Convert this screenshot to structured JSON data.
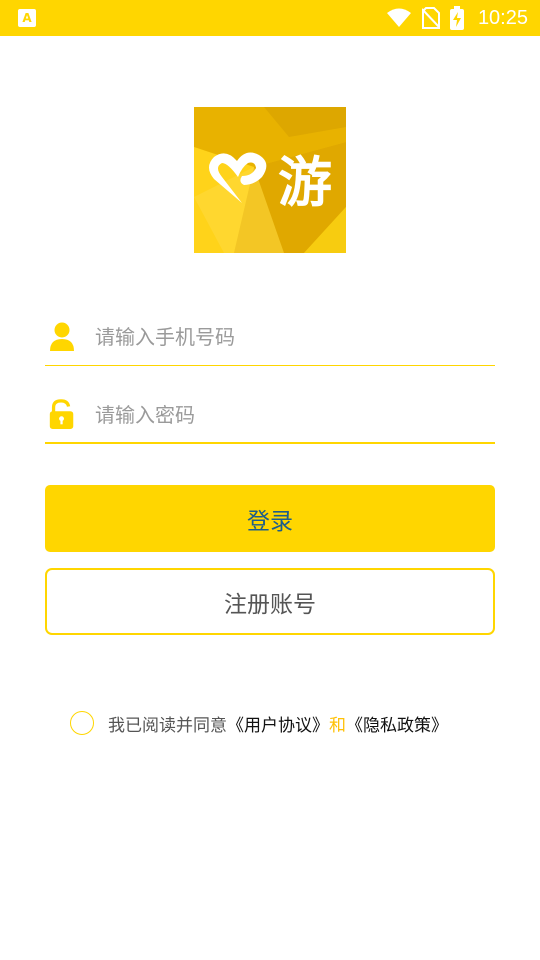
{
  "status_bar": {
    "time": "10:25",
    "app_badge": "A"
  },
  "logo": {
    "char": "游"
  },
  "phone_field": {
    "placeholder": "请输入手机号码"
  },
  "password_field": {
    "placeholder": "请输入密码"
  },
  "login_button": {
    "label": "登录"
  },
  "register_button": {
    "label": "注册账号"
  },
  "agreement": {
    "prefix": "我已阅读并同意",
    "user_agreement": "《用户协议》",
    "conjunction": "和",
    "privacy_policy": "《隐私政策》"
  },
  "colors": {
    "accent": "#FFD600",
    "link_blue": "#1d5d8a"
  }
}
